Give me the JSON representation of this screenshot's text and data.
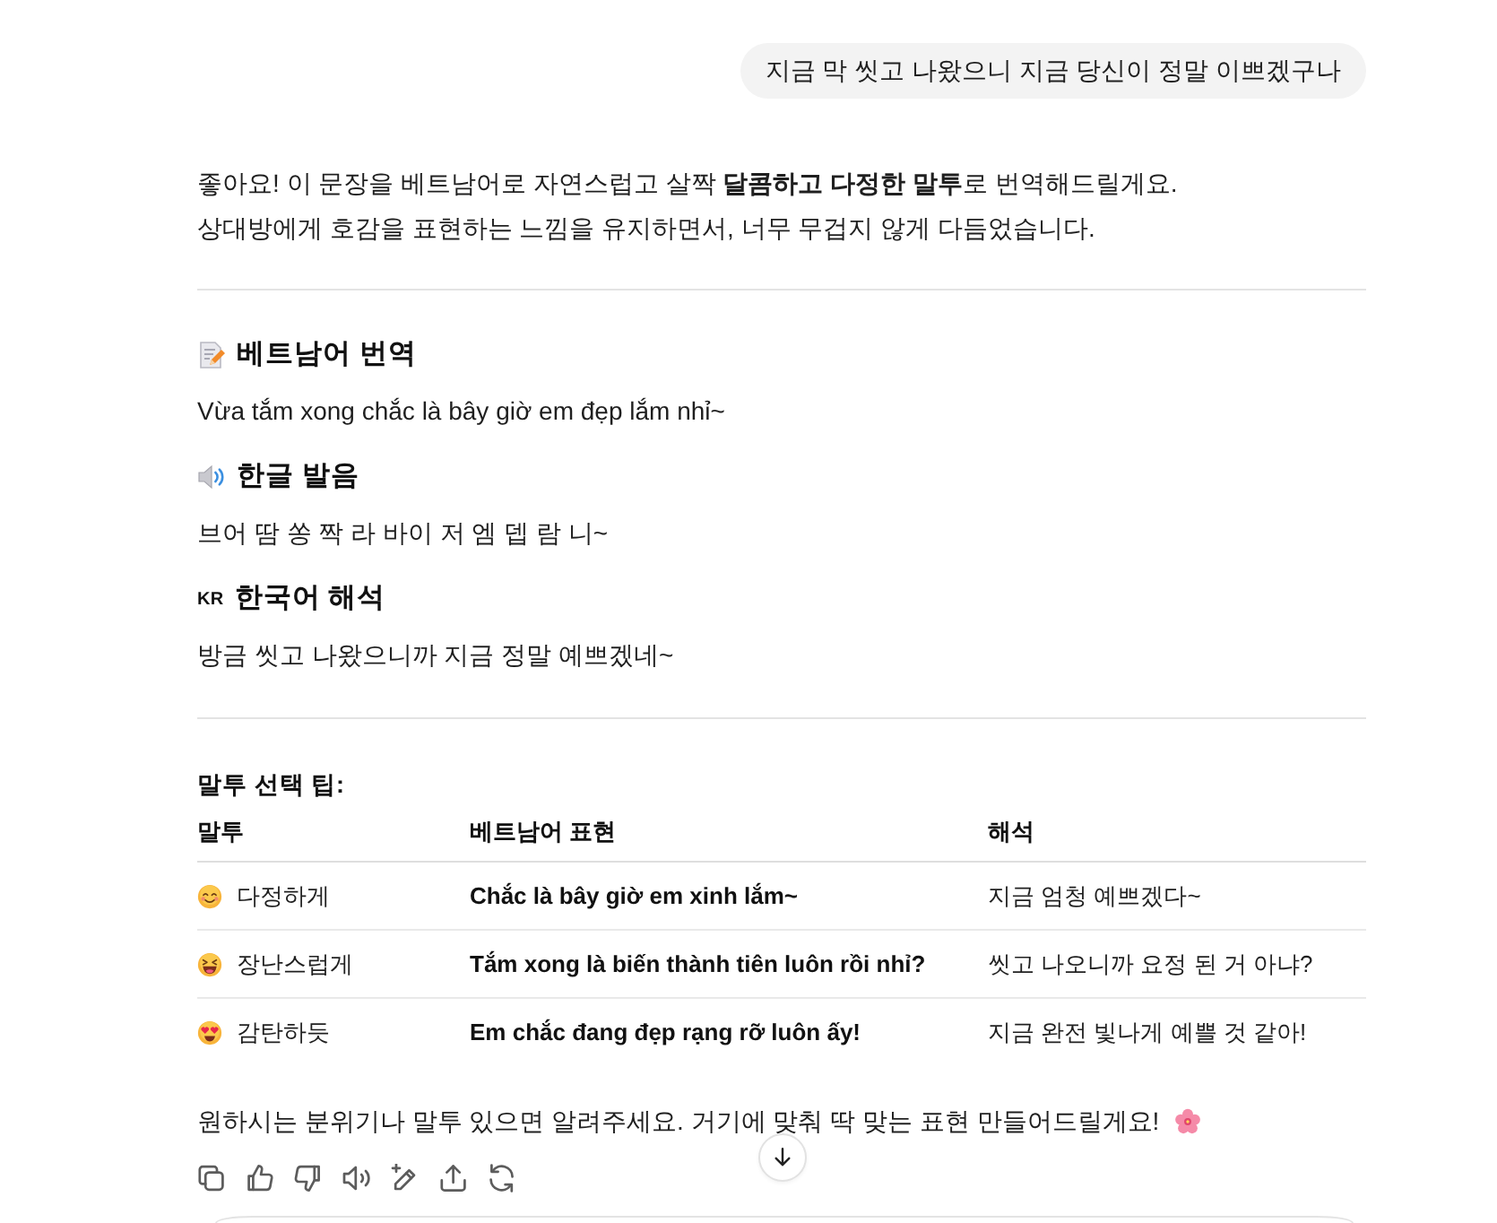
{
  "user_message": {
    "text": "지금 막 씻고 나왔으니 지금 당신이 정말 이쁘겠구나"
  },
  "intro": [
    "좋아요! 이 문장을 베트남어로 자연스럽고 살짝 **달콤하고 다정한 말투**로 번역해드릴게요.",
    "상대방에게 호감을 표현하는 느낌을 유지하면서, 너무 무겁지 않게 다듬었습니다."
  ],
  "sections": [
    {
      "kind": "memo",
      "title": "베트남어 번역",
      "text": "Vừa tắm xong chắc là bây giờ em đẹp lắm nhỉ~"
    },
    {
      "kind": "speaker",
      "title": "한글 발음",
      "text": "브어 땀 쏭 짝 라 바이 저 엠 뎁 람 니~"
    },
    {
      "kind": "letters",
      "badge": "KR",
      "title": "한국어 해석",
      "text": "방금 씻고 나왔으니까 지금 정말 예쁘겠네~"
    }
  ],
  "tips": {
    "title": "말투 선택 팁:",
    "columns": [
      "말투",
      "베트남어 표현",
      "해석"
    ],
    "rows": [
      {
        "kind": "smiling",
        "tone": "다정하게",
        "vietnamese": "Chắc là bây giờ em xinh lắm~",
        "meaning": "지금 엄청 예쁘겠다~"
      },
      {
        "kind": "laughing",
        "tone": "장난스럽게",
        "vietnamese": "Tắm xong là biến thành tiên luôn rồi nhỉ?",
        "meaning": "씻고 나오니까 요정 된 거 아냐?"
      },
      {
        "kind": "heart_eyes",
        "tone": "감탄하듯",
        "vietnamese": "Em chắc đang đẹp rạng rỡ luôn ấy!",
        "meaning": "지금 완전 빛나게 예쁠 것 같아!"
      }
    ]
  },
  "closing": {
    "text": "원하시는 분위기나 말투 있으면 알려주세요. 거기에 맞춰 딱 맞는 표현 만들어드릴게요!"
  }
}
